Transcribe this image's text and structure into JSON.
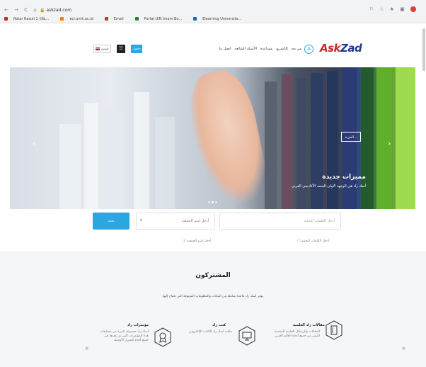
{
  "browser": {
    "url": "askzad.com",
    "nav_glyphs": "← → C ⌂",
    "secure_glyph": "🔒",
    "ext_glyphs": "⚐ ☆ ★ ▣",
    "bookmarks": [
      {
        "label": "Rotar Rasuli 1 (ISL...",
        "color": "#c62828"
      },
      {
        "label": "ecl.umk.ac.id",
        "color": "#f57c00"
      },
      {
        "label": "Email",
        "color": "#d32f2f"
      },
      {
        "label": "Portal UIN Imam Bo...",
        "color": "#2e7d32"
      },
      {
        "label": "Elearning Universita...",
        "color": "#1565c0"
      }
    ]
  },
  "header": {
    "logo_a": "Ask",
    "logo_z": "Zad",
    "home_icon": "A",
    "menu": [
      "من نحن",
      "الناشرون",
      "مساعدة",
      "الأسئلة الشائعة",
      "اتصل بنا"
    ],
    "login_label": "دخول",
    "dark_label": "☷",
    "lang_label": "عربي"
  },
  "hero": {
    "title": "مميزات جديدة",
    "subtitle": "أسك زاد هي الوجهة الأولى للبحث الأكاديمي العربي",
    "more_label": "المزيد..."
  },
  "search": {
    "button_label": "بحث",
    "association_placeholder": "أدخل اسم الجمعية",
    "keywords_placeholder": "أدخل الكلمات البحثية",
    "hint_keywords": "أدخل الكلمات البحثية",
    "hint_association": "أدخل اسم الجمعية"
  },
  "subscribers": {
    "title": "المشتركون",
    "description": "يوفر أسك زاد قاعدة شاملة من البيانات والمعلومات الموثوقة التي تحتاج إليها",
    "features": [
      {
        "title": "مقالات زاد العلمية",
        "text": "المقالات والرسائل العلمية المقدمة للنشر من جميع أنحاء العالم العربي",
        "icon": "book-icon"
      },
      {
        "title": "كتب زاد",
        "text": "مكتبة أسك زاد للكتاب الإلكتروني",
        "icon": "monitor-icon"
      },
      {
        "title": "مؤتمرات زاد",
        "text": "أسك زاد مجموعة كبيرة من مسابقات هذه المؤتمرات التي تم عقدها في جميع أنحاء الشرق الأوسط",
        "icon": "award-icon"
      }
    ]
  },
  "colors": {
    "accent": "#2aa7e0",
    "logo_red": "#c62828",
    "logo_blue": "#1e3a8a"
  }
}
